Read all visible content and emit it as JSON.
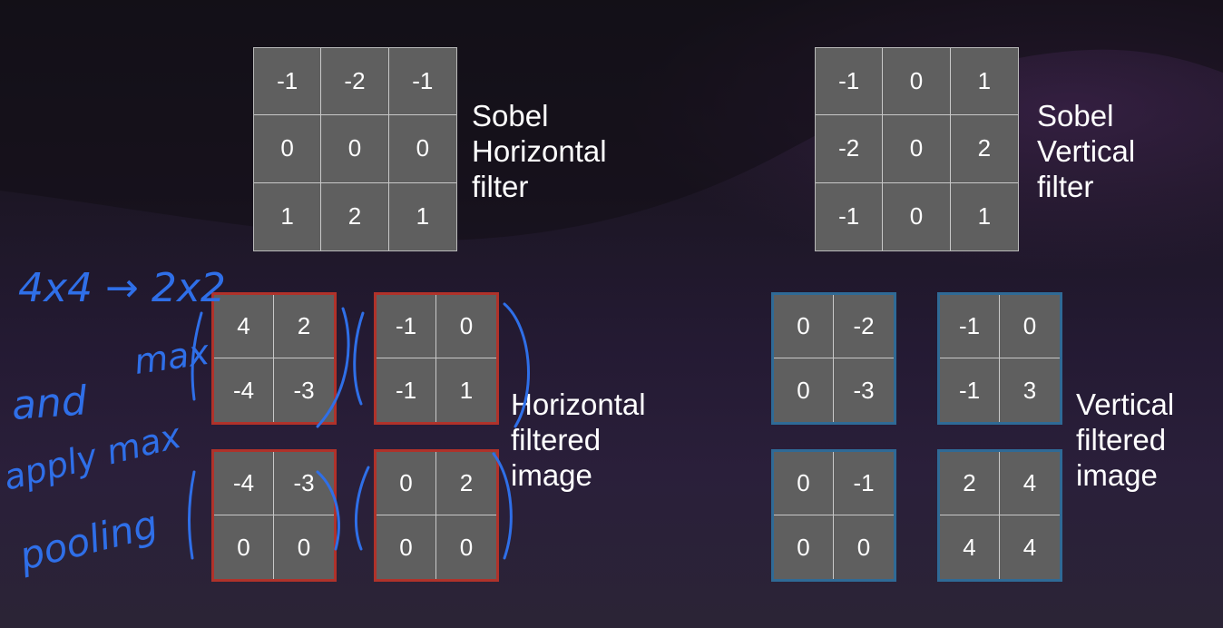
{
  "sobel_horizontal": {
    "values": [
      "-1",
      "-2",
      "-1",
      "0",
      "0",
      "0",
      "1",
      "2",
      "1"
    ],
    "label": [
      "Sobel",
      "Horizontal",
      "filter"
    ]
  },
  "sobel_vertical": {
    "values": [
      "-1",
      "0",
      "1",
      "-2",
      "0",
      "2",
      "-1",
      "0",
      "1"
    ],
    "label": [
      "Sobel",
      "Vertical",
      "filter"
    ]
  },
  "horizontal_filtered": {
    "label": [
      "Horizontal",
      "filtered",
      "image"
    ],
    "blocks": [
      [
        "4",
        "2",
        "-4",
        "-3"
      ],
      [
        "-1",
        "0",
        "-1",
        "1"
      ],
      [
        "-4",
        "-3",
        "0",
        "0"
      ],
      [
        "0",
        "2",
        "0",
        "0"
      ]
    ]
  },
  "vertical_filtered": {
    "label": [
      "Vertical",
      "filtered",
      "image"
    ],
    "blocks": [
      [
        "0",
        "-2",
        "0",
        "-3"
      ],
      [
        "-1",
        "0",
        "-1",
        "3"
      ],
      [
        "0",
        "-1",
        "0",
        "0"
      ],
      [
        "2",
        "4",
        "4",
        "4"
      ]
    ]
  },
  "handwritten_notes": {
    "line1": "4x4 → 2x2",
    "line2": "and",
    "line3": "max",
    "line4": "apply max",
    "line5": "pooling"
  },
  "colors": {
    "cell_fill": "#5f5f5f",
    "horizontal_border": "#b0322a",
    "vertical_border": "#2f6a96",
    "ink": "#2f6fe8"
  }
}
